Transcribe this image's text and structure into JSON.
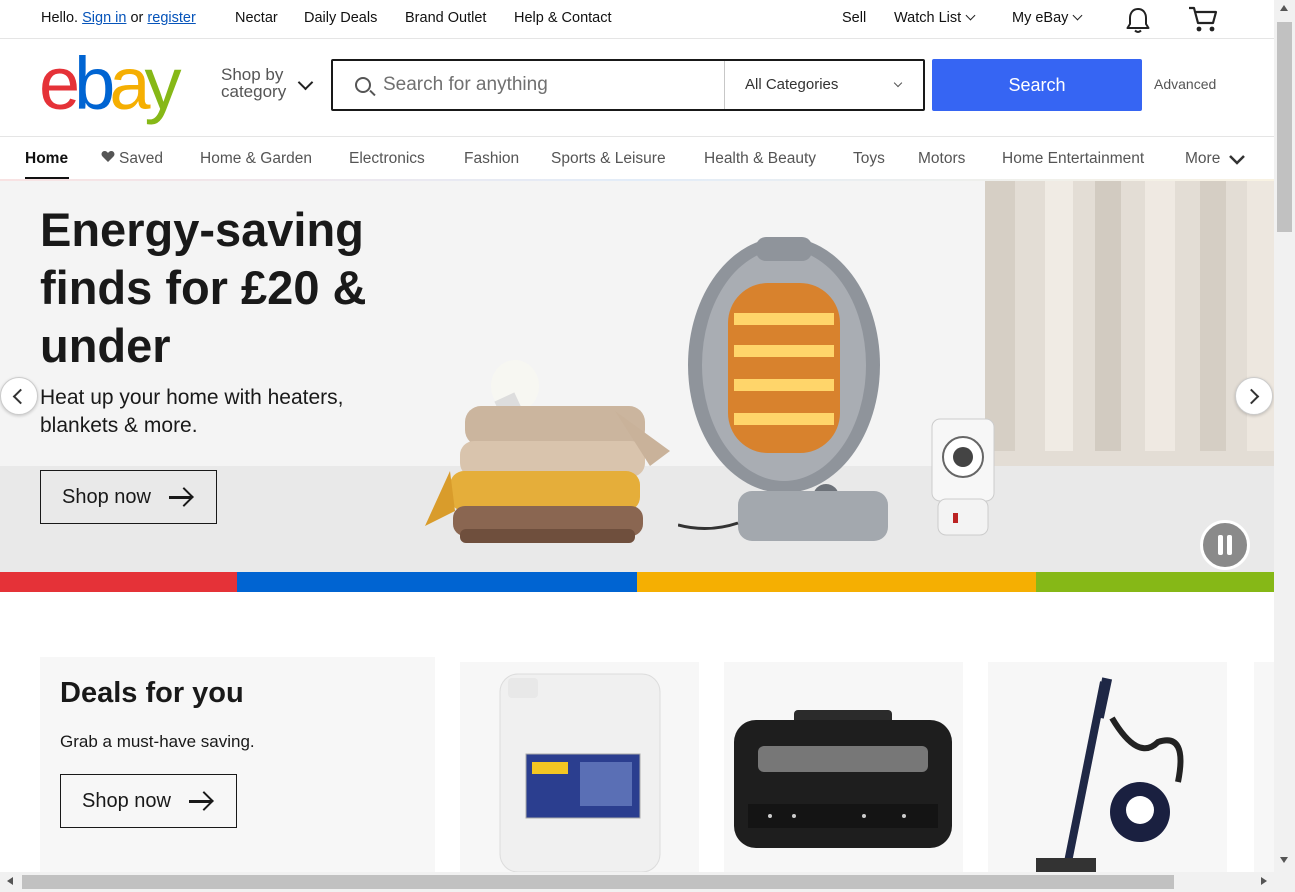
{
  "topbar": {
    "hello": "Hello.",
    "sign_in": "Sign in",
    "or": "or",
    "register": "register",
    "links": [
      "Nectar",
      "Daily Deals",
      "Brand Outlet",
      "Help & Contact"
    ],
    "sell": "Sell",
    "watch_list": "Watch List",
    "my_ebay": "My eBay",
    "icons": [
      "bell-icon",
      "cart-icon"
    ]
  },
  "header": {
    "logo_letters": [
      "e",
      "b",
      "a",
      "y"
    ],
    "logo_colors": [
      "#e53238",
      "#0064d2",
      "#f5af02",
      "#86b817"
    ],
    "shop_by_line1": "Shop by",
    "shop_by_line2": "category",
    "search_placeholder": "Search for anything",
    "category_selected": "All Categories",
    "search_button": "Search",
    "advanced": "Advanced",
    "accent_color": "#3665f3"
  },
  "nav": {
    "items": [
      "Home",
      "Saved",
      "Home & Garden",
      "Electronics",
      "Fashion",
      "Sports & Leisure",
      "Health & Beauty",
      "Toys",
      "Motors",
      "Home Entertainment",
      "More"
    ],
    "active": "Home"
  },
  "hero": {
    "title": "Energy-saving finds for £20 & under",
    "subtitle": "Heat up your home with heaters, blankets & more.",
    "button": "Shop now",
    "stripe_colors": [
      "#e53238",
      "#0064d2",
      "#f5af02",
      "#86b817"
    ]
  },
  "deals": {
    "title": "Deals for you",
    "subtitle": "Grab a must-have saving.",
    "button": "Shop now",
    "tile_icons": [
      "adblue-container-image",
      "air-fryer-grill-image",
      "vacuum-cleaner-image"
    ]
  }
}
